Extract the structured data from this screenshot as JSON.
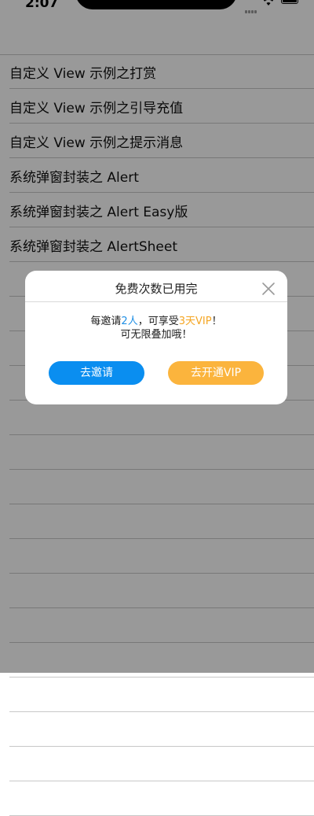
{
  "status_bar": {
    "time": "2:07"
  },
  "list": {
    "items": [
      "自定义 View 示例之打赏",
      "自定义 View 示例之引导充值",
      "自定义 View 示例之提示消息",
      "系统弹窗封装之 Alert",
      "系统弹窗封装之 Alert Easy版",
      "系统弹窗封装之 AlertSheet"
    ]
  },
  "dialog": {
    "title": "免费次数已用完",
    "message_prefix": "每邀请",
    "invite_count": "2人",
    "message_middle": "，可享受",
    "vip_reward": "3天VIP",
    "message_suffix": "！",
    "message_line2": "可无限叠加哦！",
    "invite_button": "去邀请",
    "vip_button": "去开通VIP"
  },
  "colors": {
    "accent_blue": "#0a8ef0",
    "accent_orange": "#fbb43d",
    "overlay": "rgba(0,0,0,0.4)"
  }
}
